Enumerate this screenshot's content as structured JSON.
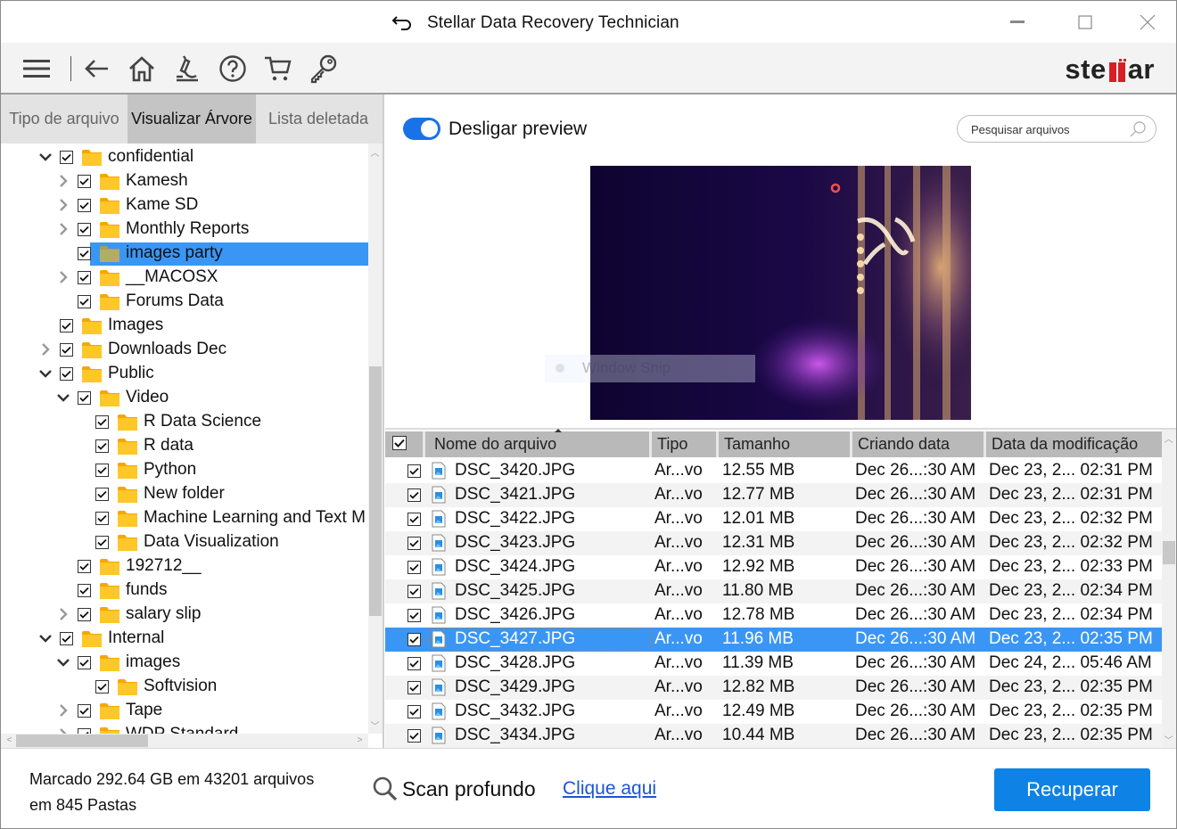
{
  "window": {
    "title": "Stellar Data Recovery Technician",
    "controls": {
      "minimize": "—",
      "maximize": "☐",
      "close": "✕"
    }
  },
  "toolbar": {
    "icons": [
      "menu-icon",
      "back-icon",
      "home-icon",
      "scan-microscope-icon",
      "help-icon",
      "cart-icon",
      "key-icon"
    ],
    "logo": {
      "pre": "ste",
      "post": "ar",
      "accent": "#d71f26"
    }
  },
  "left_pane": {
    "tabs": [
      {
        "label": "Tipo de arquivo",
        "active": false
      },
      {
        "label": "Visualizar Árvore",
        "active": true
      },
      {
        "label": "Lista deletada",
        "active": false
      }
    ],
    "tree": [
      {
        "label": "confidential",
        "level": 0,
        "expander": "expanded",
        "checked": true
      },
      {
        "label": "Kamesh",
        "level": 1,
        "expander": "collapsed",
        "checked": true
      },
      {
        "label": "Kame SD",
        "level": 1,
        "expander": "collapsed",
        "checked": true
      },
      {
        "label": "Monthly Reports",
        "level": 1,
        "expander": "collapsed",
        "checked": true
      },
      {
        "label": "images party",
        "level": 1,
        "expander": "none",
        "checked": true,
        "selected": true
      },
      {
        "label": "__MACOSX",
        "level": 1,
        "expander": "collapsed",
        "checked": true
      },
      {
        "label": "Forums Data",
        "level": 1,
        "expander": "none",
        "checked": true
      },
      {
        "label": "Images",
        "level": 0,
        "expander": "none",
        "checked": true
      },
      {
        "label": "Downloads Dec",
        "level": 0,
        "expander": "collapsed",
        "checked": true
      },
      {
        "label": "Public",
        "level": 0,
        "expander": "expanded",
        "checked": true
      },
      {
        "label": "Video",
        "level": 1,
        "expander": "expanded",
        "checked": true
      },
      {
        "label": "R Data Science",
        "level": 2,
        "expander": "none",
        "checked": true
      },
      {
        "label": "R data",
        "level": 2,
        "expander": "none",
        "checked": true
      },
      {
        "label": "Python",
        "level": 2,
        "expander": "none",
        "checked": true
      },
      {
        "label": "New folder",
        "level": 2,
        "expander": "none",
        "checked": true
      },
      {
        "label": "Machine Learning and Text M",
        "level": 2,
        "expander": "none",
        "checked": true
      },
      {
        "label": "Data Visualization",
        "level": 2,
        "expander": "none",
        "checked": true
      },
      {
        "label": "192712__",
        "level": 1,
        "expander": "none",
        "checked": true
      },
      {
        "label": "funds",
        "level": 1,
        "expander": "none",
        "checked": true
      },
      {
        "label": "salary slip",
        "level": 1,
        "expander": "collapsed",
        "checked": true
      },
      {
        "label": "Internal",
        "level": 0,
        "expander": "expanded",
        "checked": true
      },
      {
        "label": "images",
        "level": 1,
        "expander": "expanded",
        "checked": true
      },
      {
        "label": "Softvision",
        "level": 2,
        "expander": "none",
        "checked": true
      },
      {
        "label": "Tape",
        "level": 1,
        "expander": "collapsed",
        "checked": true
      },
      {
        "label": "WDP Standard",
        "level": 1,
        "expander": "collapsed",
        "checked": true
      }
    ]
  },
  "right_pane": {
    "preview_toggle": {
      "label": "Desligar preview",
      "on": true
    },
    "search": {
      "placeholder": "Pesquisar arquivos",
      "value": ""
    },
    "overlay_text": "Window Snip",
    "table": {
      "columns": [
        "Nome do arquivo",
        "Tipo",
        "Tamanho",
        "Criando data",
        "Data da modificação"
      ],
      "sorted_column": "Nome do arquivo",
      "rows": [
        {
          "name": "DSC_3420.JPG",
          "type": "Ar...vo",
          "size": "12.55 MB",
          "created": "Dec 26...:30 AM",
          "modified": "Dec 23, 2... 02:31 PM",
          "checked": true
        },
        {
          "name": "DSC_3421.JPG",
          "type": "Ar...vo",
          "size": "12.77 MB",
          "created": "Dec 26...:30 AM",
          "modified": "Dec 23, 2... 02:31 PM",
          "checked": true
        },
        {
          "name": "DSC_3422.JPG",
          "type": "Ar...vo",
          "size": "12.01 MB",
          "created": "Dec 26...:30 AM",
          "modified": "Dec 23, 2... 02:32 PM",
          "checked": true
        },
        {
          "name": "DSC_3423.JPG",
          "type": "Ar...vo",
          "size": "12.31 MB",
          "created": "Dec 26...:30 AM",
          "modified": "Dec 23, 2... 02:32 PM",
          "checked": true
        },
        {
          "name": "DSC_3424.JPG",
          "type": "Ar...vo",
          "size": "12.92 MB",
          "created": "Dec 26...:30 AM",
          "modified": "Dec 23, 2... 02:33 PM",
          "checked": true
        },
        {
          "name": "DSC_3425.JPG",
          "type": "Ar...vo",
          "size": "11.80 MB",
          "created": "Dec 26...:30 AM",
          "modified": "Dec 23, 2... 02:34 PM",
          "checked": true
        },
        {
          "name": "DSC_3426.JPG",
          "type": "Ar...vo",
          "size": "12.78 MB",
          "created": "Dec 26...:30 AM",
          "modified": "Dec 23, 2... 02:34 PM",
          "checked": true
        },
        {
          "name": "DSC_3427.JPG",
          "type": "Ar...vo",
          "size": "11.96 MB",
          "created": "Dec 26...:30 AM",
          "modified": "Dec 23, 2... 02:35 PM",
          "checked": true,
          "selected": true
        },
        {
          "name": "DSC_3428.JPG",
          "type": "Ar...vo",
          "size": "11.39 MB",
          "created": "Dec 26...:30 AM",
          "modified": "Dec 24, 2... 05:46 AM",
          "checked": true
        },
        {
          "name": "DSC_3429.JPG",
          "type": "Ar...vo",
          "size": "12.82 MB",
          "created": "Dec 26...:30 AM",
          "modified": "Dec 23, 2... 02:35 PM",
          "checked": true
        },
        {
          "name": "DSC_3432.JPG",
          "type": "Ar...vo",
          "size": "12.49 MB",
          "created": "Dec 26...:30 AM",
          "modified": "Dec 23, 2... 02:35 PM",
          "checked": true
        },
        {
          "name": "DSC_3434.JPG",
          "type": "Ar...vo",
          "size": "10.44 MB",
          "created": "Dec 26...:30 AM",
          "modified": "Dec 23, 2... 02:35 PM",
          "checked": true
        }
      ]
    }
  },
  "footer": {
    "status_line1": "Marcado 292.64 GB em 43201 arquivos",
    "status_line2": "em 845 Pastas",
    "deep_scan_label": "Scan profundo",
    "deep_scan_link": "Clique aqui",
    "recover_button": "Recuperar"
  },
  "colors": {
    "accent": "#0f82e6",
    "selection": "#3a96f5",
    "folder": "#ffc727",
    "brand_red": "#d71f26"
  }
}
